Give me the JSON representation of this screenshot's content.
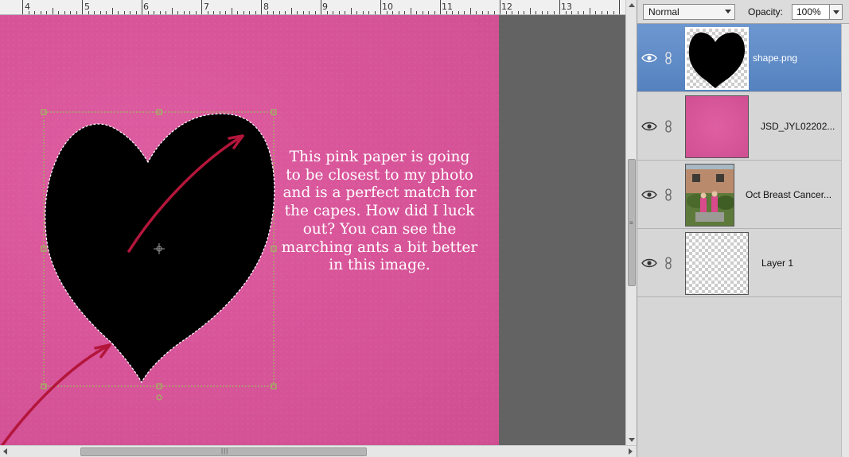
{
  "ruler": {
    "labels": [
      "4",
      "5",
      "6",
      "7",
      "8",
      "9",
      "10",
      "11",
      "12",
      "13"
    ]
  },
  "canvas": {
    "note_text": "This pink paper is going to be closest to my photo and is a perfect match for the capes. How did I luck out? You can see the marching ants a bit better in this image.",
    "colors": {
      "paper": "#d9559a",
      "arrow": "#b3163b",
      "selection_handle": "#8fd14f"
    }
  },
  "layers_panel": {
    "blend_mode": "Normal",
    "opacity_label": "Opacity:",
    "opacity_value": "100%",
    "layers": [
      {
        "name": "shape.png",
        "selected": true,
        "thumbnail": "heart-shape"
      },
      {
        "name": "JSD_JYL02202...",
        "selected": false,
        "thumbnail": "pink-paper"
      },
      {
        "name": "Oct Breast Cancer...",
        "selected": false,
        "thumbnail": "photo"
      },
      {
        "name": "Layer 1",
        "selected": false,
        "thumbnail": "transparent"
      }
    ]
  }
}
